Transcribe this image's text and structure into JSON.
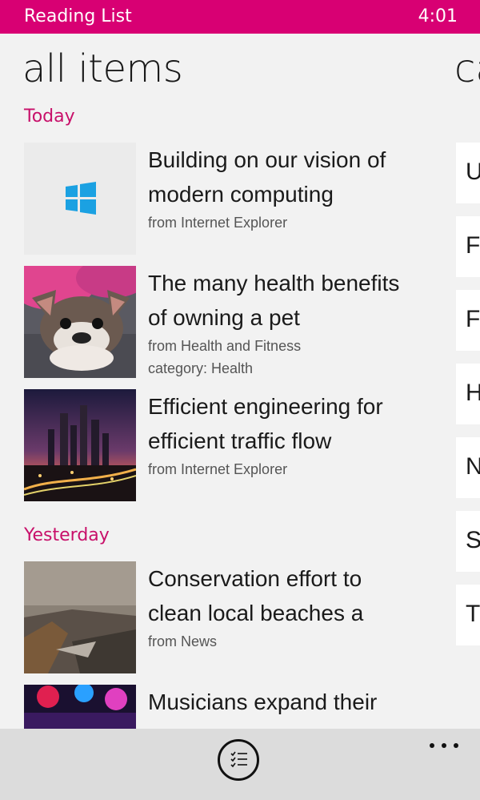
{
  "status_bar": {
    "app_title": "Reading List",
    "time": "4:01"
  },
  "pivot": {
    "current_title": "all items",
    "next_title_peek": "ca"
  },
  "sections": [
    {
      "header": "Today",
      "items": [
        {
          "title_lines": [
            "Building on our vision of",
            "modern computing"
          ],
          "meta": [
            "from Internet Explorer"
          ],
          "thumb_icon": "windows-logo-icon"
        },
        {
          "title_lines": [
            "The many health benefits",
            "of owning a pet"
          ],
          "meta": [
            "from Health and Fitness",
            "category: Health"
          ],
          "thumb_icon": "dog-photo"
        },
        {
          "title_lines": [
            "Efficient engineering for",
            "efficient traffic flow"
          ],
          "meta": [
            "from Internet Explorer"
          ],
          "thumb_icon": "city-night-photo"
        }
      ]
    },
    {
      "header": "Yesterday",
      "items": [
        {
          "title_lines": [
            "Conservation effort to",
            "clean local beaches a"
          ],
          "meta": [
            "from News"
          ],
          "thumb_icon": "coastline-photo"
        },
        {
          "title_lines": [
            "Musicians expand their"
          ],
          "meta": [],
          "thumb_icon": "concert-photo"
        }
      ]
    }
  ],
  "category_peek": [
    "U",
    "Fi",
    "Fo",
    "H",
    "N",
    "S",
    "T"
  ],
  "app_bar": {
    "primary_icon": "checklist-icon",
    "more_icon": "more-ellipsis-icon"
  },
  "colors": {
    "accent": "#d80073",
    "section_header": "#c8106a",
    "windows_logo": "#1ba1e2"
  }
}
